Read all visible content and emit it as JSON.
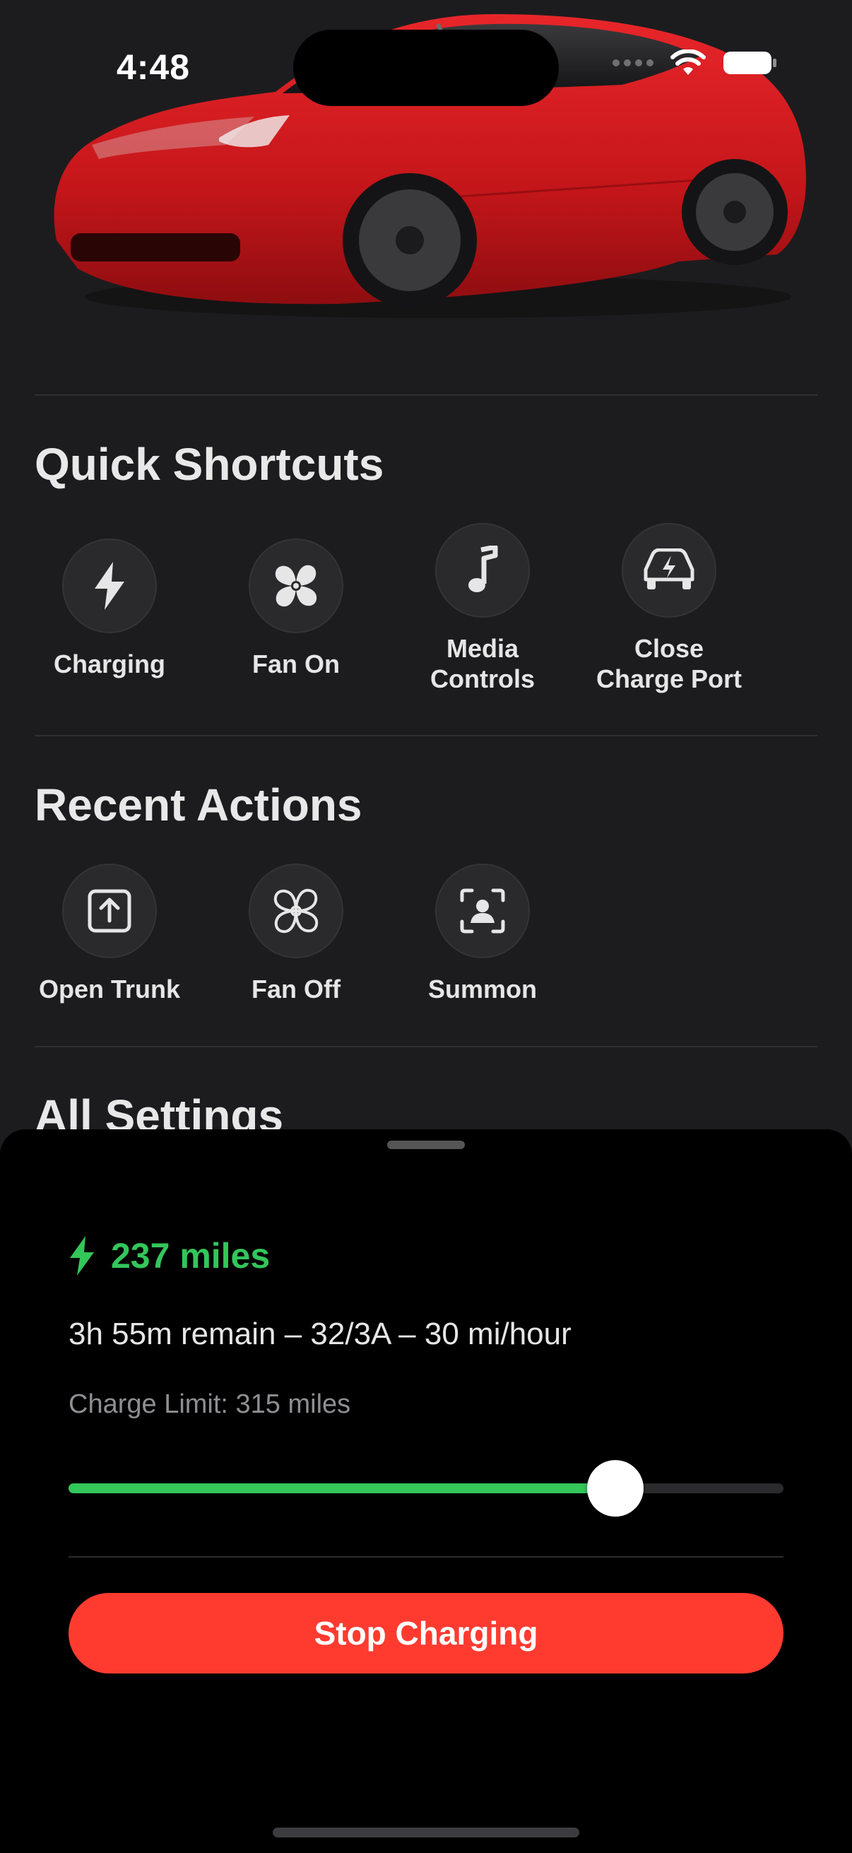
{
  "status_bar": {
    "time": "4:48"
  },
  "shortcuts": {
    "title": "Quick Shortcuts",
    "items": [
      {
        "label": "Charging",
        "icon": "bolt-icon"
      },
      {
        "label": "Fan On",
        "icon": "fan-filled-icon"
      },
      {
        "label": "Media\nControls",
        "icon": "music-note-icon"
      },
      {
        "label": "Close\nCharge Port",
        "icon": "car-charge-icon"
      }
    ]
  },
  "recent": {
    "title": "Recent Actions",
    "items": [
      {
        "label": "Open Trunk",
        "icon": "upload-box-icon"
      },
      {
        "label": "Fan Off",
        "icon": "fan-outline-icon"
      },
      {
        "label": "Summon",
        "icon": "summon-icon"
      }
    ]
  },
  "all_settings": {
    "title": "All Settings"
  },
  "charging": {
    "range": "237 miles",
    "remain": "3h 55m remain – 32/3A – 30 mi/hour",
    "limit": "Charge Limit: 315 miles",
    "limit_fraction": 0.765,
    "stop_label": "Stop Charging"
  },
  "colors": {
    "accent_green": "#33c65a",
    "stop_red": "#ff3b30",
    "car_red": "#d11a1a"
  }
}
